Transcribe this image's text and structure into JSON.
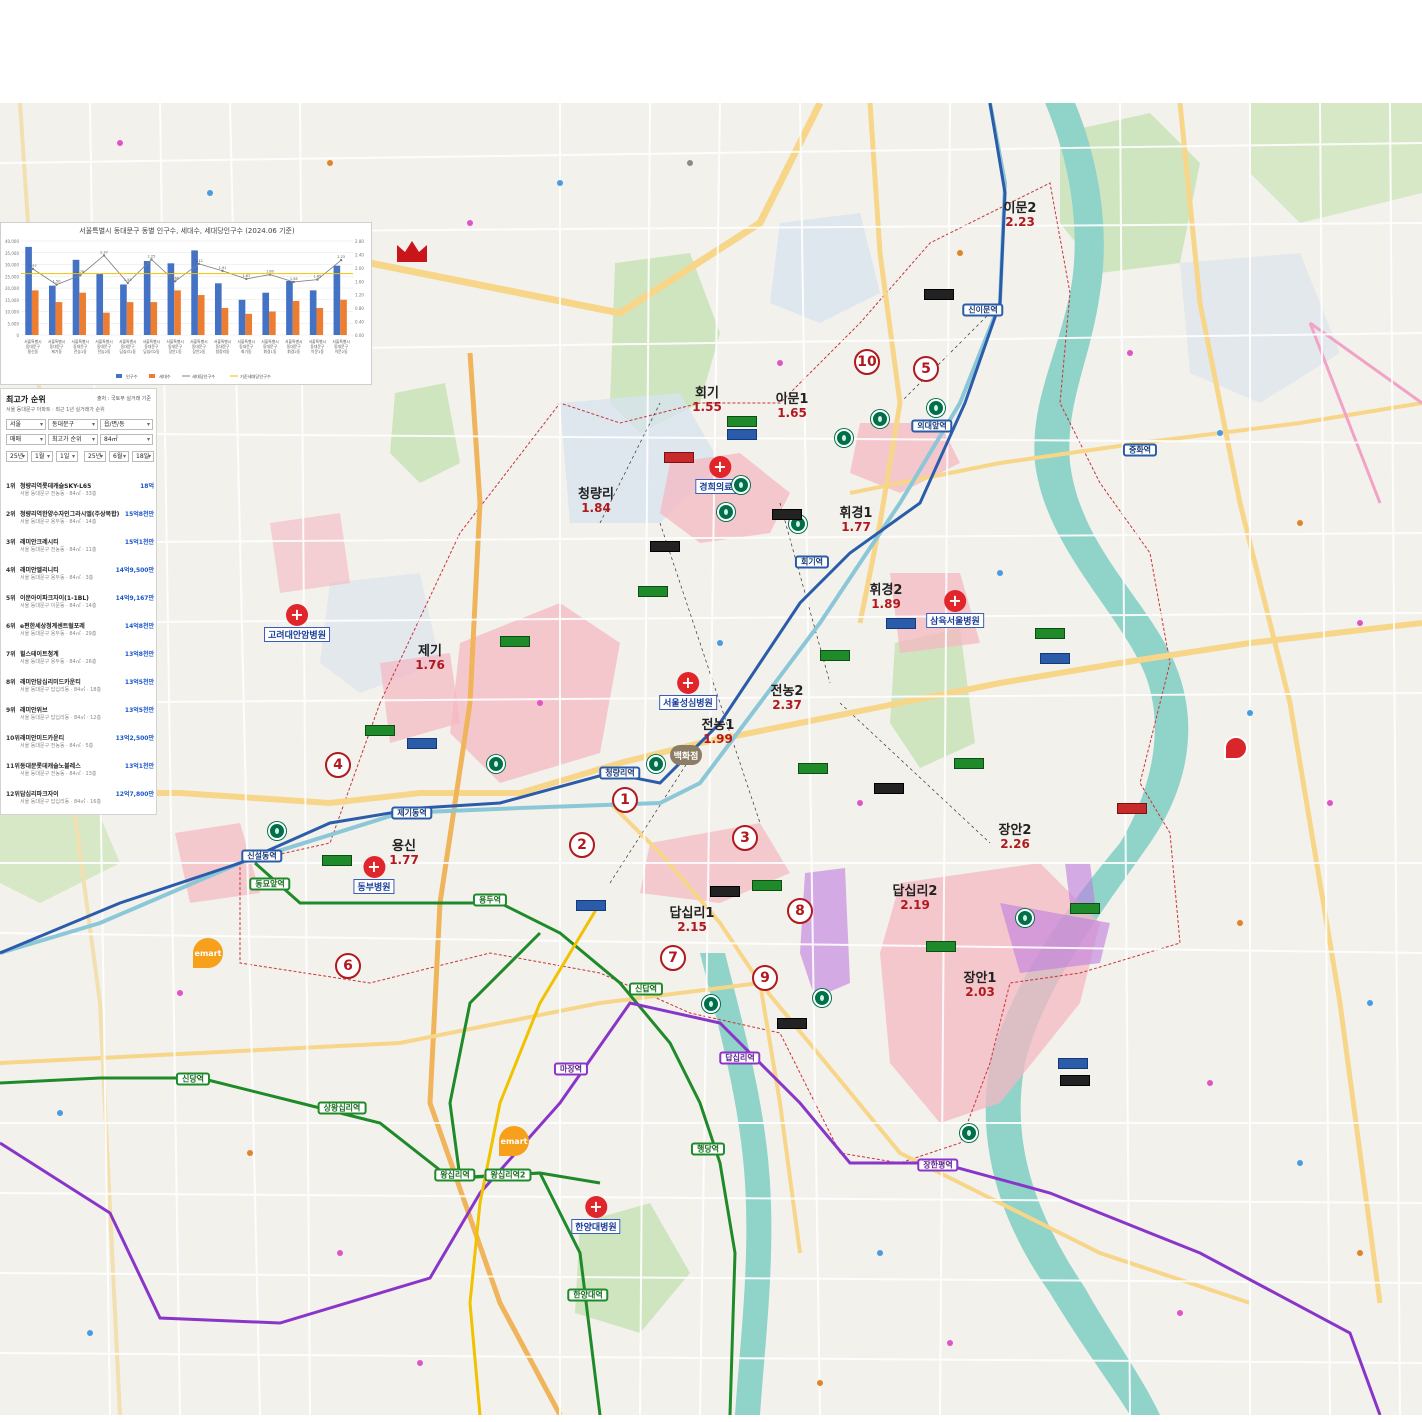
{
  "map": {
    "dong_labels": [
      {
        "name": "이문2",
        "value": "2.23"
      },
      {
        "name": "회기",
        "value": "1.55"
      },
      {
        "name": "이문1",
        "value": "1.65"
      },
      {
        "name": "청량리",
        "value": "1.84"
      },
      {
        "name": "휘경1",
        "value": "1.77"
      },
      {
        "name": "휘경2",
        "value": "1.89"
      },
      {
        "name": "제기",
        "value": "1.76"
      },
      {
        "name": "전농2",
        "value": "2.37"
      },
      {
        "name": "전농1",
        "value": "1.99"
      },
      {
        "name": "용신",
        "value": "1.77"
      },
      {
        "name": "장안2",
        "value": "2.26"
      },
      {
        "name": "답십리2",
        "value": "2.19"
      },
      {
        "name": "답십리1",
        "value": "2.15"
      },
      {
        "name": "장안1",
        "value": "2.03"
      }
    ],
    "zone_numbers": [
      "1",
      "2",
      "3",
      "4",
      "5",
      "6",
      "7",
      "8",
      "9",
      "10"
    ],
    "stations": [
      "신이문역",
      "외대앞역",
      "회기역",
      "중화역",
      "청량리역",
      "제기동역",
      "신설동역",
      "동묘앞역",
      "용두역",
      "신답역",
      "답십리역",
      "마장역",
      "장한평역",
      "상왕십리역",
      "신당역",
      "왕십리역",
      "행당역",
      "한양대역",
      "왕십리역2"
    ],
    "hospitals": [
      "경희의료원",
      "고려대안암병원",
      "서울성심병원",
      "삼육서울병원",
      "동부병원",
      "한양대병원"
    ],
    "emart_label": "emart",
    "dept_store": "백화점",
    "colors": {
      "line1": "#2a5caa",
      "line2": "#1f8a2a",
      "line5": "#8a35c9",
      "gyeongui": "#8cc7d8",
      "zone_pink": "#f4b8c2",
      "zone_purple": "#c07be0",
      "river": "#8fd3c9"
    }
  },
  "chart": {
    "title": "서울특별시 동대문구 동별 인구수, 세대수, 세대당인구수 (2024.06 기준)",
    "legend": [
      "인구수",
      "세대수",
      "세대당인구수",
      "기준세대당인구수"
    ]
  },
  "ranking": {
    "title": "최고가 순위",
    "source": "출처 : 국토부 실거래 기준",
    "subtitle": "서울 동대문구 아파트 · 최근 1년 실거래가 순위",
    "filters": [
      "서울",
      "동대문구",
      "읍/면/동",
      "매매",
      "최고가 순위",
      "84㎡",
      "25년",
      "1월",
      "1일",
      "25년",
      "6월",
      "18일"
    ],
    "items": [
      {
        "rank": "1위",
        "name": "청량리역롯데캐슬SKY-L65",
        "price": "18억",
        "detail": "서울 동대문구 전농동 · 84㎡ · 33층"
      },
      {
        "rank": "2위",
        "name": "청량리역한양수자인그라시엘(주상복합)",
        "price": "15억8천만",
        "detail": "서울 동대문구 용두동 · 84㎡ · 14층"
      },
      {
        "rank": "3위",
        "name": "래미안크레시티",
        "price": "15억1천만",
        "detail": "서울 동대문구 전농동 · 84㎡ · 11층"
      },
      {
        "rank": "4위",
        "name": "래미안엘리니티",
        "price": "14억9,500만",
        "detail": "서울 동대문구 용두동 · 84㎡ · 3층"
      },
      {
        "rank": "5위",
        "name": "이문아이파크자이(1-1BL)",
        "price": "14억9,167만",
        "detail": "서울 동대문구 이문동 · 84㎡ · 14층"
      },
      {
        "rank": "6위",
        "name": "e편한세상청계센트럴포레",
        "price": "14억8천만",
        "detail": "서울 동대문구 용두동 · 84㎡ · 29층"
      },
      {
        "rank": "7위",
        "name": "힐스테이트청계",
        "price": "13억8천만",
        "detail": "서울 동대문구 용두동 · 84㎡ · 26층"
      },
      {
        "rank": "8위",
        "name": "래미안답십리미드카운티",
        "price": "13억5천만",
        "detail": "서울 동대문구 답십리동 · 84㎡ · 18층"
      },
      {
        "rank": "9위",
        "name": "래미안위브",
        "price": "13억5천만",
        "detail": "서울 동대문구 답십리동 · 84㎡ · 12층"
      },
      {
        "rank": "10위",
        "name": "래미안미드카운티",
        "price": "13억2,500만",
        "detail": "서울 동대문구 전농동 · 84㎡ · 5층"
      },
      {
        "rank": "11위",
        "name": "동대문롯데캐슬노블레스",
        "price": "13억1천만",
        "detail": "서울 동대문구 전농동 · 84㎡ · 13층"
      },
      {
        "rank": "12위",
        "name": "답십리파크자이",
        "price": "12억7,800만",
        "detail": "서울 동대문구 답십리동 · 84㎡ · 16층"
      }
    ]
  },
  "chart_data": {
    "type": "bar",
    "title": "서울특별시 동대문구 동별 인구수, 세대수, 세대당인구수 (2024.06 기준)",
    "categories": [
      "서울특별시 동대문구 용신동",
      "서울특별시 동대문구 제기동",
      "서울특별시 동대문구 전농1동",
      "서울특별시 동대문구 전농2동",
      "서울특별시 동대문구 답십리1동",
      "서울특별시 동대문구 답십리2동",
      "서울특별시 동대문구 장안1동",
      "서울특별시 동대문구 장안2동",
      "서울특별시 동대문구 청량리동",
      "서울특별시 동대문구 회기동",
      "서울특별시 동대문구 휘경1동",
      "서울특별시 동대문구 휘경2동",
      "서울특별시 동대문구 이문1동",
      "서울특별시 동대문구 이문2동"
    ],
    "series": [
      {
        "name": "인구수",
        "axis": "left",
        "values": [
          37500,
          21000,
          32000,
          26000,
          21500,
          31500,
          30500,
          36000,
          22000,
          15000,
          18000,
          23000,
          19000,
          29500
        ]
      },
      {
        "name": "세대수",
        "axis": "left",
        "values": [
          19000,
          14000,
          18000,
          9500,
          14000,
          14000,
          19000,
          17000,
          11500,
          9000,
          10000,
          14500,
          11500,
          15000
        ]
      },
      {
        "name": "세대당인구수",
        "axis": "right",
        "values": [
          1.97,
          1.5,
          1.78,
          2.37,
          1.55,
          2.25,
          1.6,
          2.12,
          1.91,
          1.67,
          1.8,
          1.58,
          1.65,
          2.23
        ]
      },
      {
        "name": "기준세대당인구수",
        "axis": "right",
        "values": [
          1.83,
          1.83,
          1.83,
          1.83,
          1.83,
          1.83,
          1.83,
          1.83,
          1.83,
          1.83,
          1.83,
          1.83,
          1.83,
          1.83
        ]
      }
    ],
    "ylim_left": [
      0,
      40000
    ],
    "ylim_right": [
      0,
      2.8
    ],
    "legend_position": "bottom"
  }
}
